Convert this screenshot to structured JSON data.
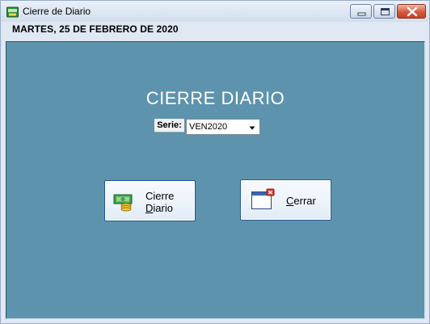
{
  "window": {
    "title": "Cierre de Diario",
    "icons": {
      "app": "cash-register-icon",
      "minimize": "minimize-icon",
      "maximize": "maximize-icon",
      "close": "close-icon"
    }
  },
  "header": {
    "date": "MARTES, 25 DE FEBRERO DE 2020"
  },
  "main": {
    "title": "CIERRE DIARIO",
    "serie": {
      "label": "Serie:",
      "selected": "VEN2020"
    }
  },
  "buttons": {
    "cierre": {
      "line1": "Cierre",
      "line2_first": "D",
      "line2_rest": "iario",
      "icon": "money-cash-icon"
    },
    "cerrar": {
      "first": "C",
      "rest": "errar",
      "icon": "close-window-icon"
    }
  },
  "colors": {
    "panel": "#5d93ad",
    "title_text": "#ffffff",
    "close_button": "#d55a3e"
  }
}
